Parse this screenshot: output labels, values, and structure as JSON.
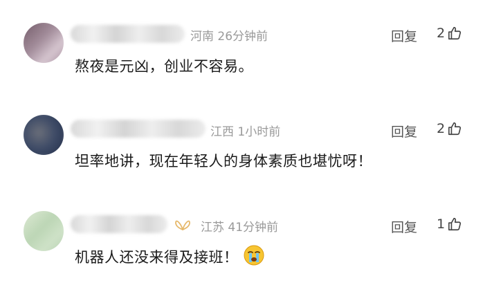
{
  "comments": [
    {
      "location": "河南",
      "time": "26分钟前",
      "reply_label": "回复",
      "likes": "2",
      "content": "熬夜是元凶，创业不容易。",
      "avatar_colors": [
        "#7a6470",
        "#b8a7b4",
        "#c8b4c2",
        "#a78f9f"
      ]
    },
    {
      "location": "江西",
      "time": "1小时前",
      "reply_label": "回复",
      "likes": "2",
      "content": "坦率地讲，现在年轻人的身体素质也堪忧呀！",
      "avatar_colors": [
        "#2f3a52",
        "#4b5a7a",
        "#6a6f7d",
        "#3c4e6a"
      ]
    },
    {
      "location": "江苏",
      "time": "41分钟前",
      "reply_label": "回复",
      "likes": "1",
      "content": "机器人还没来得及接班！",
      "avatar_colors": [
        "#cfe0c8",
        "#b9d4b2",
        "#e2ecd8",
        "#c4d9bf"
      ],
      "badge_color": "#e6b86a"
    }
  ]
}
